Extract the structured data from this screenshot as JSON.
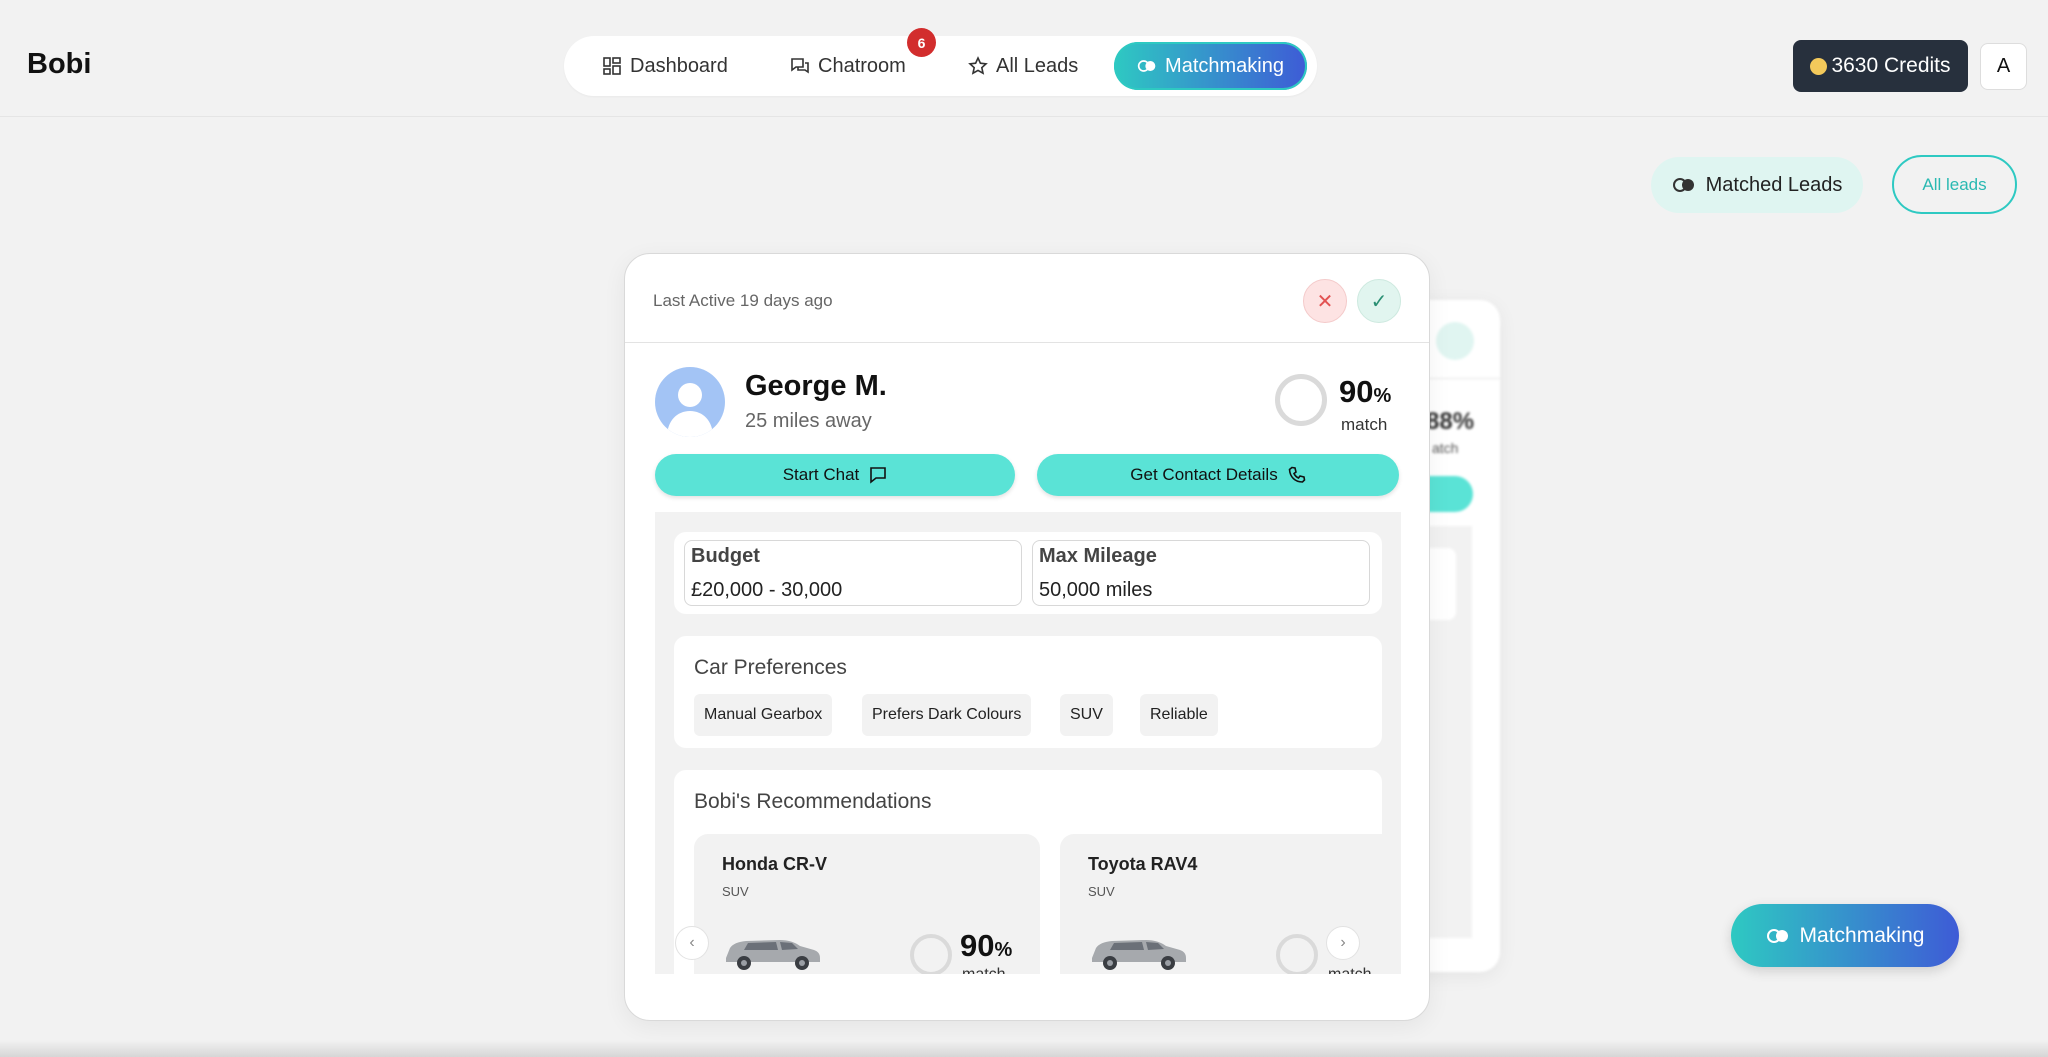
{
  "brand": "Bobi",
  "nav": {
    "dashboard": "Dashboard",
    "chatroom": "Chatroom",
    "chatroom_badge": "6",
    "all_leads": "All Leads",
    "matchmaking": "Matchmaking"
  },
  "account": {
    "credits": "3630 Credits",
    "avatar_initial": "A"
  },
  "view_toggle": {
    "matched": "Matched Leads",
    "all": "All leads"
  },
  "back_card": {
    "pct": "88%",
    "sub": "atch"
  },
  "lead": {
    "last_active": "Last Active 19 days ago",
    "name": "George M.",
    "distance": "25 miles away",
    "match_pct": "90",
    "match_unit": "%",
    "match_label": "match",
    "start_chat": "Start Chat",
    "get_contact": "Get Contact Details"
  },
  "budget": {
    "label": "Budget",
    "value": "£20,000 - 30,000"
  },
  "mileage": {
    "label": "Max Mileage",
    "value": "50,000 miles"
  },
  "preferences": {
    "title": "Car Preferences",
    "tags": [
      "Manual Gearbox",
      "Prefers Dark Colours",
      "SUV",
      "Reliable"
    ]
  },
  "recommendations": {
    "title": "Bobi's Recommendations",
    "items": [
      {
        "name": "Honda CR-V",
        "type": "SUV",
        "pct": "90",
        "unit": "%",
        "label": "match"
      },
      {
        "name": "Toyota RAV4",
        "type": "SUV",
        "pct": "",
        "unit": "",
        "label": "match"
      }
    ]
  },
  "fab": "Matchmaking",
  "colors": {
    "accent": "#5ae3d6",
    "gradient_start": "#2ec9c2",
    "gradient_end": "#3e5bd6",
    "badge": "#d22d2d",
    "credits_bg": "#27303d"
  }
}
